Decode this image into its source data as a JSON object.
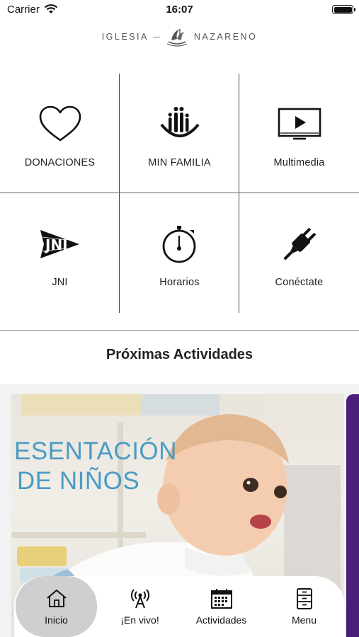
{
  "status_bar": {
    "carrier": "Carrier",
    "time": "16:07"
  },
  "brand": {
    "left": "IGLESIA",
    "right": "NAZARENO"
  },
  "menu_grid": [
    {
      "label": "DONACIONES",
      "icon": "heart-icon"
    },
    {
      "label": "MIN FAMILIA",
      "icon": "family-ministry-icon"
    },
    {
      "label": "Multimedia",
      "icon": "play-screen-icon"
    },
    {
      "label": "JNI",
      "icon": "jni-logo-icon"
    },
    {
      "label": "Horarios",
      "icon": "stopwatch-icon"
    },
    {
      "label": "Conéctate",
      "icon": "plug-icon"
    }
  ],
  "activities": {
    "title": "Próximas Actividades",
    "banner": {
      "line1": "ESENTACIÓN",
      "line2": "DE NIÑOS"
    }
  },
  "tab_bar": [
    {
      "label": "Inicio",
      "icon": "home-icon",
      "active": true
    },
    {
      "label": "¡En vivo!",
      "icon": "broadcast-icon",
      "active": false
    },
    {
      "label": "Actividades",
      "icon": "calendar-icon",
      "active": false
    },
    {
      "label": "Menu",
      "icon": "cabinet-icon",
      "active": false
    }
  ],
  "colors": {
    "banner_text": "#4a9cc4",
    "side_card": "#4b1e7a",
    "active_tab": "#cfcfcf"
  }
}
